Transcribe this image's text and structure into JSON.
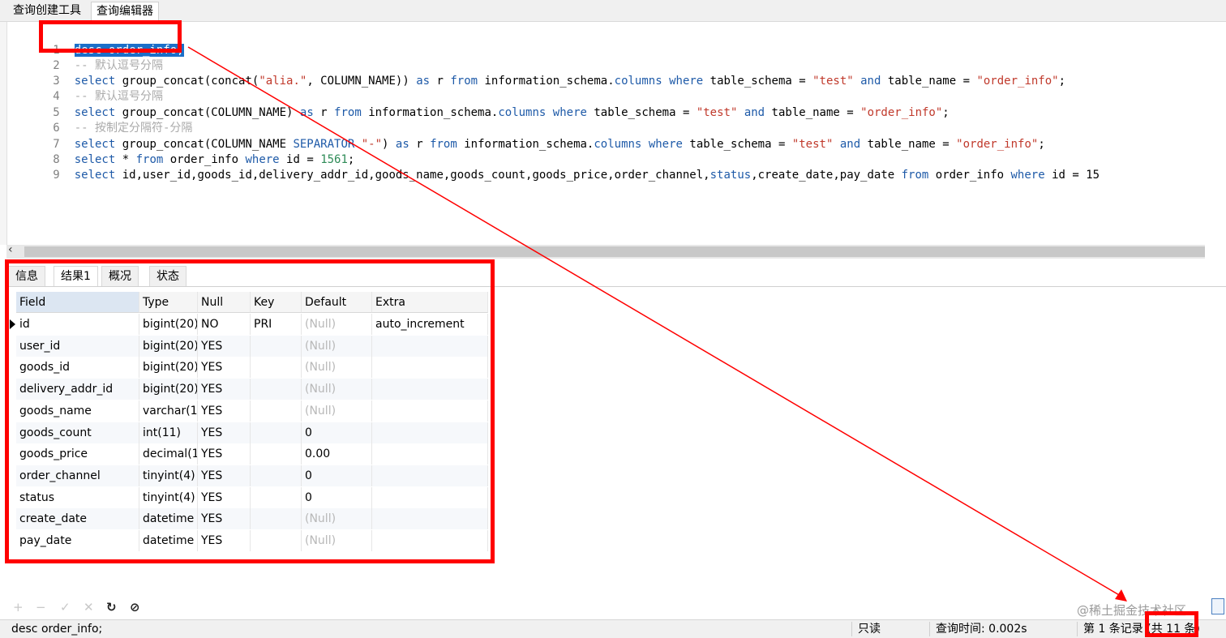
{
  "top_tabs": [
    "查询创建工具",
    "查询编辑器"
  ],
  "editor": {
    "line_numbers": [
      "1",
      "2",
      "3",
      "4",
      "5",
      "6",
      "7",
      "8",
      "9"
    ],
    "line1": "desc order_info;",
    "line2_comment": "-- 默认逗号分隔",
    "line4_comment": "-- 默认逗号分隔",
    "line6_comment": "-- 按制定分隔符-分隔",
    "kw_select": "select",
    "kw_as": "as",
    "kw_from": "from",
    "kw_where": "where",
    "kw_and": "and",
    "kw_separator": "SEPARATOR",
    "kw_columns": "columns",
    "kw_status": "status",
    "line3_a": "group_concat(concat(",
    "line3_str1": "\"alia.\"",
    "line3_b": ", COLUMN_NAME)) ",
    "line3_c": " r ",
    "line3_d": " information_schema.",
    "line3_e": " table_schema = ",
    "str_test": "\"test\"",
    "line3_f": " table_name = ",
    "str_order_info": "\"order_info\"",
    "semicolon": ";",
    "line5_a": "group_concat(COLUMN_NAME) ",
    "line7_a": "group_concat(COLUMN_NAME ",
    "line7_sep_str": "\"-\"",
    "line7_b": ") ",
    "line8_a": " * ",
    "line8_b": " order_info ",
    "line8_c": " id = ",
    "line8_num": "1561",
    "line9_a": " id,user_id,goods_id,delivery_addr_id,goods_name,goods_count,goods_price,order_channel,",
    "line9_b": ",create_date,pay_date ",
    "line9_c": " order_info ",
    "line9_d": " id = 15"
  },
  "result_tabs": [
    "信息",
    "结果1",
    "概况",
    "状态"
  ],
  "grid": {
    "headers": [
      "Field",
      "Type",
      "Null",
      "Key",
      "Default",
      "Extra"
    ],
    "rows": [
      [
        "id",
        "bigint(20)",
        "NO",
        "PRI",
        "(Null)",
        "auto_increment"
      ],
      [
        "user_id",
        "bigint(20)",
        "YES",
        "",
        "(Null)",
        ""
      ],
      [
        "goods_id",
        "bigint(20)",
        "YES",
        "",
        "(Null)",
        ""
      ],
      [
        "delivery_addr_id",
        "bigint(20)",
        "YES",
        "",
        "(Null)",
        ""
      ],
      [
        "goods_name",
        "varchar(1(",
        "YES",
        "",
        "(Null)",
        ""
      ],
      [
        "goods_count",
        "int(11)",
        "YES",
        "",
        "0",
        ""
      ],
      [
        "goods_price",
        "decimal(1",
        "YES",
        "",
        "0.00",
        ""
      ],
      [
        "order_channel",
        "tinyint(4)",
        "YES",
        "",
        "0",
        ""
      ],
      [
        "status",
        "tinyint(4)",
        "YES",
        "",
        "0",
        ""
      ],
      [
        "create_date",
        "datetime",
        "YES",
        "",
        "(Null)",
        ""
      ],
      [
        "pay_date",
        "datetime",
        "YES",
        "",
        "(Null)",
        ""
      ]
    ]
  },
  "toolbar": {
    "add": "+",
    "remove": "−",
    "apply": "✓",
    "discard": "✕",
    "refresh": "↻",
    "stop": "⊘"
  },
  "watermark": "@稀土掘金技术社区",
  "status": {
    "sql": "desc order_info;",
    "mode": "只读",
    "query_time": "查询时间: 0.002s",
    "records": "第 1 条记录 (共 11 条)"
  },
  "colors": {
    "annotation": "#ff0000",
    "keyword": "#1e5aa8",
    "string": "#c0392b",
    "selection": "#1b6fc8"
  }
}
